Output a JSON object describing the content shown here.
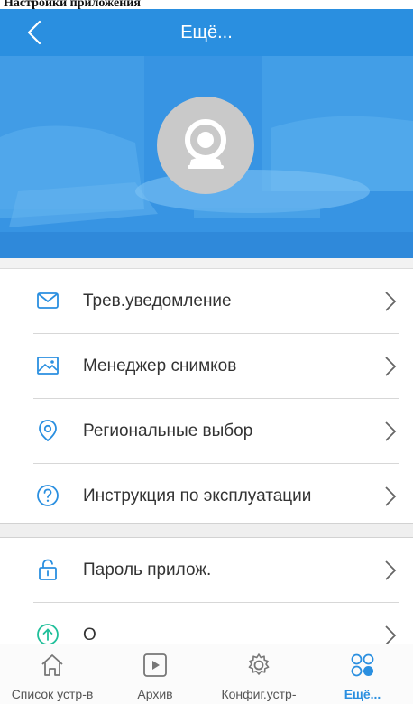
{
  "page_caption": "Настройки приложения",
  "nav": {
    "title": "Ещё..."
  },
  "menu_group_1": [
    {
      "label": "Трев.уведомление",
      "icon": "envelope-icon"
    },
    {
      "label": "Менеджер снимков",
      "icon": "image-icon"
    },
    {
      "label": "Региональные выбор",
      "icon": "location-pin-icon"
    },
    {
      "label": "Инструкция по эксплуатации",
      "icon": "help-circle-icon"
    }
  ],
  "menu_group_2": [
    {
      "label": "Пароль прилож.",
      "icon": "lock-icon"
    },
    {
      "label": "О",
      "icon": "arrow-up-circle-icon"
    }
  ],
  "tabs": [
    {
      "label": "Список устр-в",
      "icon": "home-icon"
    },
    {
      "label": "Архив",
      "icon": "play-icon"
    },
    {
      "label": "Конфиг.устр-",
      "icon": "gear-icon"
    },
    {
      "label": "Ещё...",
      "icon": "more-icon",
      "active": true
    }
  ],
  "colors": {
    "accent": "#2a8fe0",
    "text": "#333333",
    "inactive": "#555555"
  }
}
